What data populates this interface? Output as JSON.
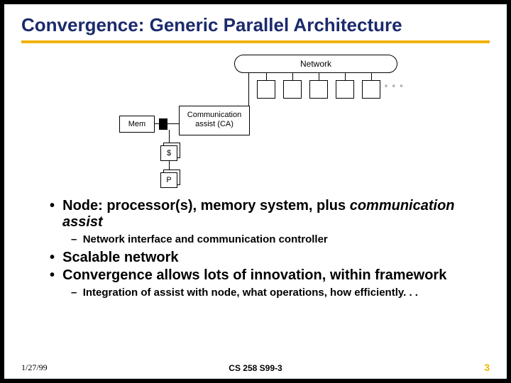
{
  "title": "Convergence: Generic Parallel Architecture",
  "diagram": {
    "network": "Network",
    "mem": "Mem",
    "ca_line1": "Communication",
    "ca_line2": "assist (CA)",
    "cache": "$",
    "proc": "P",
    "ellipsis": "° ° °"
  },
  "bullets": {
    "b1_a": "Node: processor(s), memory system, plus ",
    "b1_a_em": "communication assist",
    "b2_a": "Network interface and communication controller",
    "b1_b": "Scalable network",
    "b1_c": "Convergence allows lots of innovation, within framework",
    "b2_b": "Integration of assist with node, what operations, how efficiently. . ."
  },
  "footer": {
    "date": "1/27/99",
    "mid": "CS 258 S99-3",
    "page": "3"
  }
}
